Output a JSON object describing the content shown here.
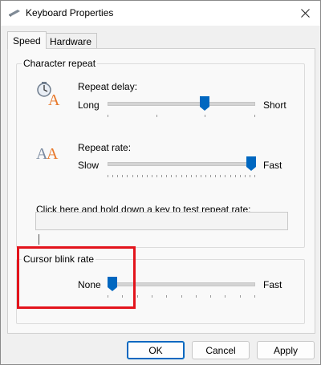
{
  "window": {
    "title": "Keyboard Properties"
  },
  "tabs": [
    {
      "label": "Speed"
    },
    {
      "label": "Hardware"
    }
  ],
  "character_repeat": {
    "group_label": "Character repeat",
    "repeat_delay": {
      "label": "Repeat delay:",
      "min_label": "Long",
      "max_label": "Short",
      "level": 0.66
    },
    "repeat_rate": {
      "label": "Repeat rate:",
      "min_label": "Slow",
      "max_label": "Fast",
      "level": 1.0
    },
    "test_label": "Click here and hold down a key to test repeat rate:",
    "test_value": ""
  },
  "cursor_blink": {
    "group_label": "Cursor blink rate",
    "min_label": "None",
    "max_label": "Fast",
    "level": 0.0
  },
  "buttons": {
    "ok": "OK",
    "cancel": "Cancel",
    "apply": "Apply"
  },
  "colors": {
    "accent": "#0067c0",
    "highlight": "#e3141c",
    "icon_orange": "#e8782a",
    "icon_gray": "#7a8aa0"
  }
}
